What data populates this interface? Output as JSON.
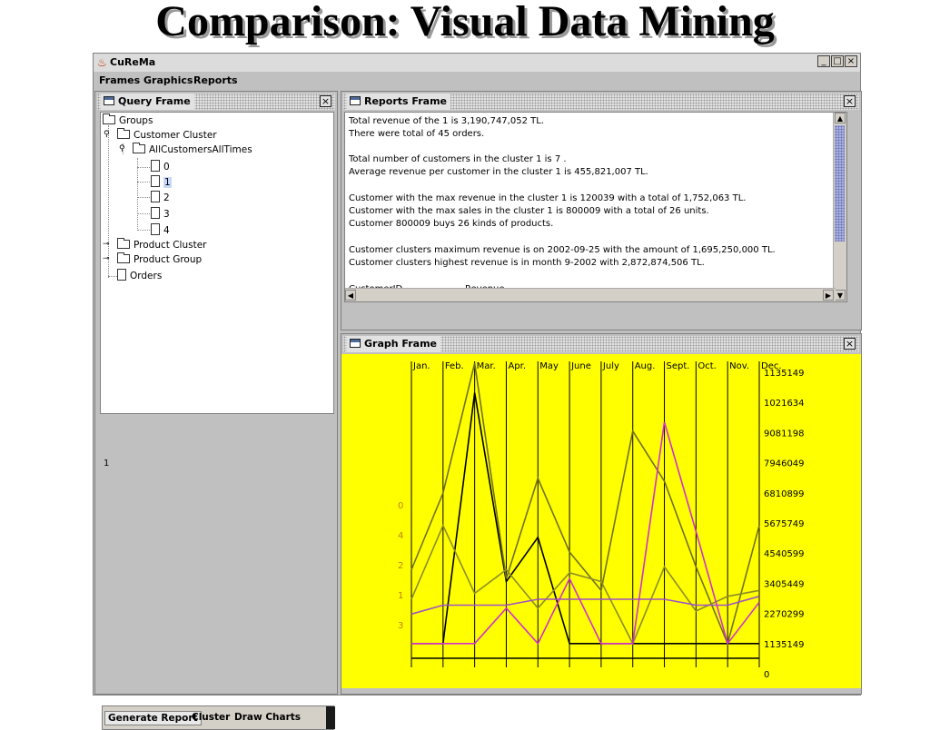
{
  "slide_title": "Comparison: Visual Data Mining",
  "window": {
    "title": "CuReMa",
    "controls": [
      "_",
      "□",
      "×"
    ]
  },
  "menu": [
    "Frames",
    "Graphics",
    "Reports"
  ],
  "query_frame": {
    "title": "Query Frame",
    "tree": {
      "root": "Groups",
      "customer_cluster": "Customer Cluster",
      "all_customers": "AllCustomersAllTimes",
      "clusters": [
        "0",
        "1",
        "2",
        "3",
        "4"
      ],
      "product_cluster": "Product Cluster",
      "product_group": "Product Group",
      "orders": "Orders"
    },
    "selected_value": "1"
  },
  "toolbar": {
    "generate_report": "Generate Report",
    "cluster": "Cluster",
    "draw_charts": "Draw Charts"
  },
  "reports_frame": {
    "title": "Reports Frame",
    "lines": [
      "Total revenue of the 1 is 3,190,747,052 TL.",
      "There were total of 45 orders.",
      "",
      "Total number of customers in the cluster 1 is 7 .",
      "Average revenue per customer in the cluster 1 is 455,821,007 TL.",
      "",
      "Customer with the max revenue in the cluster 1 is 120039 with a total of 1,752,063 TL.",
      "Customer with the max sales in the cluster 1 is 800009 with a total of 26 units.",
      "Customer 800009 buys 26 kinds of products.",
      "",
      "Customer clusters maximum revenue is on 2002-09-25 with the amount of  1,695,250,000 TL.",
      "Customer clusters highest revenue is in month 9-2002 with 2,872,874,506 TL.",
      "",
      ""
    ],
    "table_headers": [
      "CustomerID",
      "Revenue"
    ]
  },
  "graph_frame": {
    "title": "Graph Frame"
  },
  "colors": {
    "graph_bg": "#ffff00",
    "selection": "#c8d8f8",
    "scroll_thumb": "#a8b0e0"
  },
  "chart_data": {
    "type": "line",
    "categories": [
      "Jan.",
      "Feb.",
      "Mar.",
      "Apr.",
      "May",
      "June",
      "July",
      "Aug.",
      "Sept.",
      "Oct.",
      "Nov.",
      "Dec."
    ],
    "right_axis_ticks": [
      "1135149",
      "1021634",
      "9081198",
      "7946049",
      "6810899",
      "5675749",
      "4540599",
      "3405449",
      "2270299",
      "1135149",
      "0"
    ],
    "left_axis_labels": [
      "0",
      "4",
      "2",
      "1",
      "3"
    ],
    "ylim": [
      0,
      10
    ],
    "series": [
      {
        "color": "#000000",
        "values": [
          0.5,
          0.5,
          9.0,
          2.6,
          4.1,
          0.5,
          0.5,
          0.5,
          0.5,
          0.5,
          0.5,
          0.5
        ]
      },
      {
        "color": "#707020",
        "values": [
          3.0,
          5.6,
          10.0,
          2.7,
          6.1,
          3.6,
          2.3,
          7.7,
          6.0,
          3.1,
          0.5,
          4.5
        ]
      },
      {
        "color": "#8c8c2a",
        "values": [
          2.0,
          4.5,
          2.2,
          3.0,
          1.7,
          2.9,
          2.6,
          0.5,
          3.1,
          1.6,
          2.1,
          2.3
        ]
      },
      {
        "color": "#a050c8",
        "values": [
          1.5,
          1.8,
          1.8,
          1.8,
          2.0,
          2.0,
          2.0,
          2.0,
          2.0,
          1.8,
          1.8,
          2.1
        ]
      },
      {
        "color": "#d030d0",
        "values": [
          0.5,
          0.5,
          0.5,
          1.7,
          0.5,
          2.7,
          0.5,
          0.5,
          8.0,
          4.3,
          0.5,
          1.9
        ]
      }
    ]
  }
}
